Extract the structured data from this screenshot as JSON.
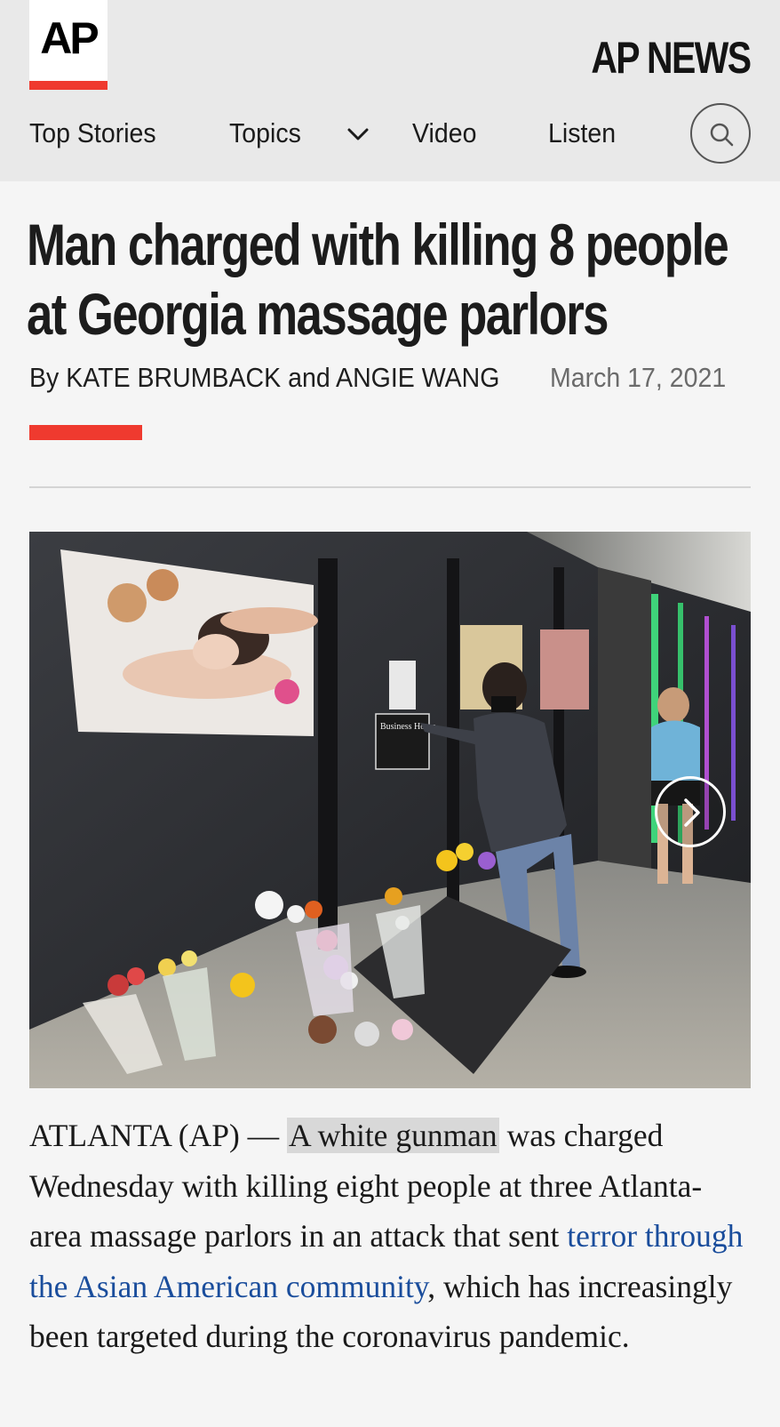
{
  "header": {
    "logo_text": "AP",
    "brand": "AP NEWS",
    "nav": {
      "top_stories": "Top Stories",
      "topics": "Topics",
      "video": "Video",
      "listen": "Listen"
    },
    "icons": {
      "topics_dropdown": "chevron-down-icon",
      "search": "search-icon"
    }
  },
  "article": {
    "headline": "Man charged with killing 8 people at Georgia massage parlors",
    "byline_prefix": "By",
    "author_1": "KATE BRUMBACK",
    "byline_and": "and",
    "author_2": "ANGIE WANG",
    "date": "March 17, 2021",
    "photo": {
      "next_icon": "chevron-right-icon",
      "sign_title": "Business Hours"
    },
    "lead": {
      "dateline": "ATLANTA (AP) — ",
      "highlighted": "A white gunman",
      "text_1": " was charged Wednesday with killing eight people at three Atlanta-area massage parlors in an attack that sent ",
      "link_text": "terror through the Asian American community",
      "text_2": ", which has increasingly been targeted during the coronavirus pandemic."
    }
  },
  "colors": {
    "accent_red": "#ef3a2f",
    "link_blue": "#1a4d9c",
    "header_bg": "#e9e9e9",
    "page_bg": "#f5f5f5"
  }
}
